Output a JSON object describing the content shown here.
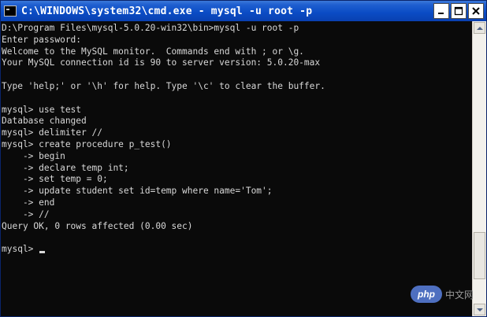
{
  "window": {
    "title": "C:\\WINDOWS\\system32\\cmd.exe - mysql -u root -p",
    "icon": "console-icon",
    "buttons": {
      "minimize": "_",
      "maximize": "□",
      "close": "×"
    }
  },
  "console": {
    "lines": [
      "D:\\Program Files\\mysql-5.0.20-win32\\bin>mysql -u root -p",
      "Enter password:",
      "Welcome to the MySQL monitor.  Commands end with ; or \\g.",
      "Your MySQL connection id is 90 to server version: 5.0.20-max",
      "",
      "Type 'help;' or '\\h' for help. Type '\\c' to clear the buffer.",
      "",
      "mysql> use test",
      "Database changed",
      "mysql> delimiter //",
      "mysql> create procedure p_test()",
      "    -> begin",
      "    -> declare temp int;",
      "    -> set temp = 0;",
      "    -> update student set id=temp where name='Tom';",
      "    -> end",
      "    -> //",
      "Query OK, 0 rows affected (0.00 sec)",
      "",
      "mysql> "
    ]
  },
  "watermark": {
    "logo": "php",
    "text": "中文网"
  },
  "colors": {
    "titlebar": "#0a4bc4",
    "console_bg": "#0a0a0a",
    "console_text": "#d8d8d8",
    "watermark_logo": "#4e6fc0"
  }
}
